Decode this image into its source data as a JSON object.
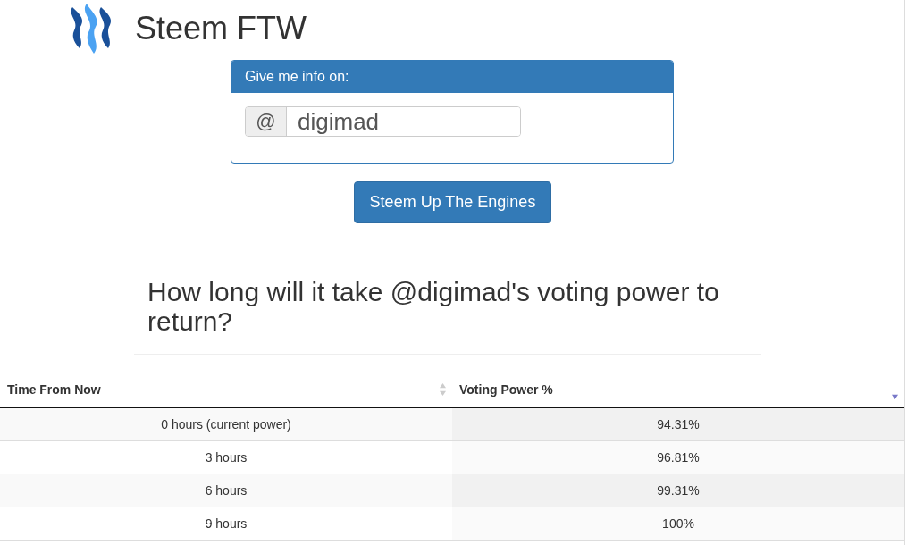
{
  "header": {
    "title": "Steem FTW"
  },
  "panel": {
    "heading": "Give me info on:",
    "addon": "@",
    "value": "digimad"
  },
  "button": "Steem Up The Engines",
  "question": "How long will it take @digimad's voting power to return?",
  "table": {
    "columns": [
      {
        "label": "Time From Now",
        "sorted_descending": false
      },
      {
        "label": "Voting Power %",
        "sorted_descending": true
      }
    ],
    "rows": [
      [
        "0 hours (current power)",
        "94.31%"
      ],
      [
        "3 hours",
        "96.81%"
      ],
      [
        "6 hours",
        "99.31%"
      ],
      [
        "9 hours",
        "100%"
      ]
    ]
  }
}
